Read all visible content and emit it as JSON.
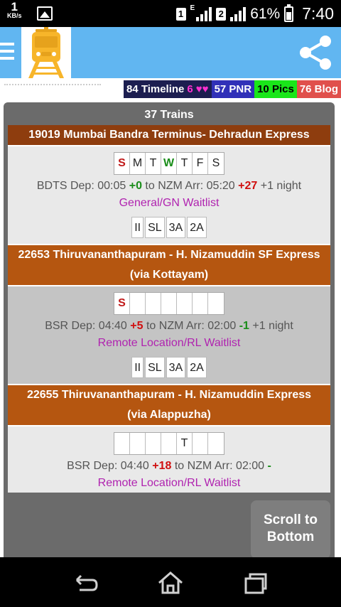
{
  "status_bar": {
    "speed_value": "1",
    "speed_unit": "KB/s",
    "sim1": "1",
    "network_type": "E",
    "sim2": "2",
    "battery_percent": "61%",
    "battery_level": 0.61,
    "time": "7:40"
  },
  "app_bar": {
    "menu_icon": "hamburger-menu-icon",
    "logo_icon": "train-logo-icon",
    "share_icon": "share-icon",
    "brand_color": "#61b6f1"
  },
  "links": {
    "timeline_label": "84 Timeline",
    "timeline_count": "6",
    "timeline_hearts": "♥♥",
    "pnr_label": "57 PNR",
    "pics_label": "10 Pics",
    "blog_label": "76 Blog"
  },
  "trains_count_label": "37 Trains",
  "trains": [
    {
      "title": "19019 Mumbai Bandra Terminus- Dehradun Express",
      "days": [
        {
          "label": "S",
          "style": "red"
        },
        {
          "label": "M",
          "style": ""
        },
        {
          "label": "T",
          "style": ""
        },
        {
          "label": "W",
          "style": "green"
        },
        {
          "label": "T",
          "style": ""
        },
        {
          "label": "F",
          "style": ""
        },
        {
          "label": "S",
          "style": ""
        }
      ],
      "dep_text": "BDTS Dep: 00:05",
      "dep_delay": "+0",
      "dep_delay_style": "green",
      "arr_text": "to NZM Arr: 05:20",
      "arr_delay": "+27",
      "arr_delay_style": "red",
      "night": "+1 night",
      "quota": "General/GN Waitlist",
      "classes": [
        "II",
        "SL",
        "3A",
        "2A"
      ]
    },
    {
      "title": "22653 Thiruvananthapuram - H. Nizamuddin SF Express (via Kottayam)",
      "days": [
        {
          "label": "S",
          "style": "red"
        },
        {
          "label": "",
          "style": ""
        },
        {
          "label": "",
          "style": ""
        },
        {
          "label": "",
          "style": ""
        },
        {
          "label": "",
          "style": ""
        },
        {
          "label": "",
          "style": ""
        },
        {
          "label": "",
          "style": ""
        }
      ],
      "dep_text": "BSR Dep: 04:40",
      "dep_delay": "+5",
      "dep_delay_style": "red",
      "arr_text": "to NZM Arr: 02:00",
      "arr_delay": "-1",
      "arr_delay_style": "green",
      "night": "+1 night",
      "quota": "Remote Location/RL Waitlist",
      "classes": [
        "II",
        "SL",
        "3A",
        "2A"
      ]
    },
    {
      "title": "22655 Thiruvananthapuram - H. Nizamuddin Express (via Alappuzha)",
      "days": [
        {
          "label": "",
          "style": ""
        },
        {
          "label": "",
          "style": ""
        },
        {
          "label": "",
          "style": ""
        },
        {
          "label": "",
          "style": ""
        },
        {
          "label": "T",
          "style": ""
        },
        {
          "label": "",
          "style": ""
        },
        {
          "label": "",
          "style": ""
        }
      ],
      "dep_text": "BSR Dep: 04:40",
      "dep_delay": "+18",
      "dep_delay_style": "red",
      "arr_text": "to NZM Arr: 02:00",
      "arr_delay": "-",
      "arr_delay_style": "green",
      "night": "",
      "quota": "Remote Location/RL Waitlist",
      "classes": []
    }
  ],
  "scroll_button_label": "Scroll to Bottom",
  "nav_bar": {
    "back_icon": "back-icon",
    "home_icon": "home-icon",
    "recents_icon": "recent-apps-icon"
  }
}
